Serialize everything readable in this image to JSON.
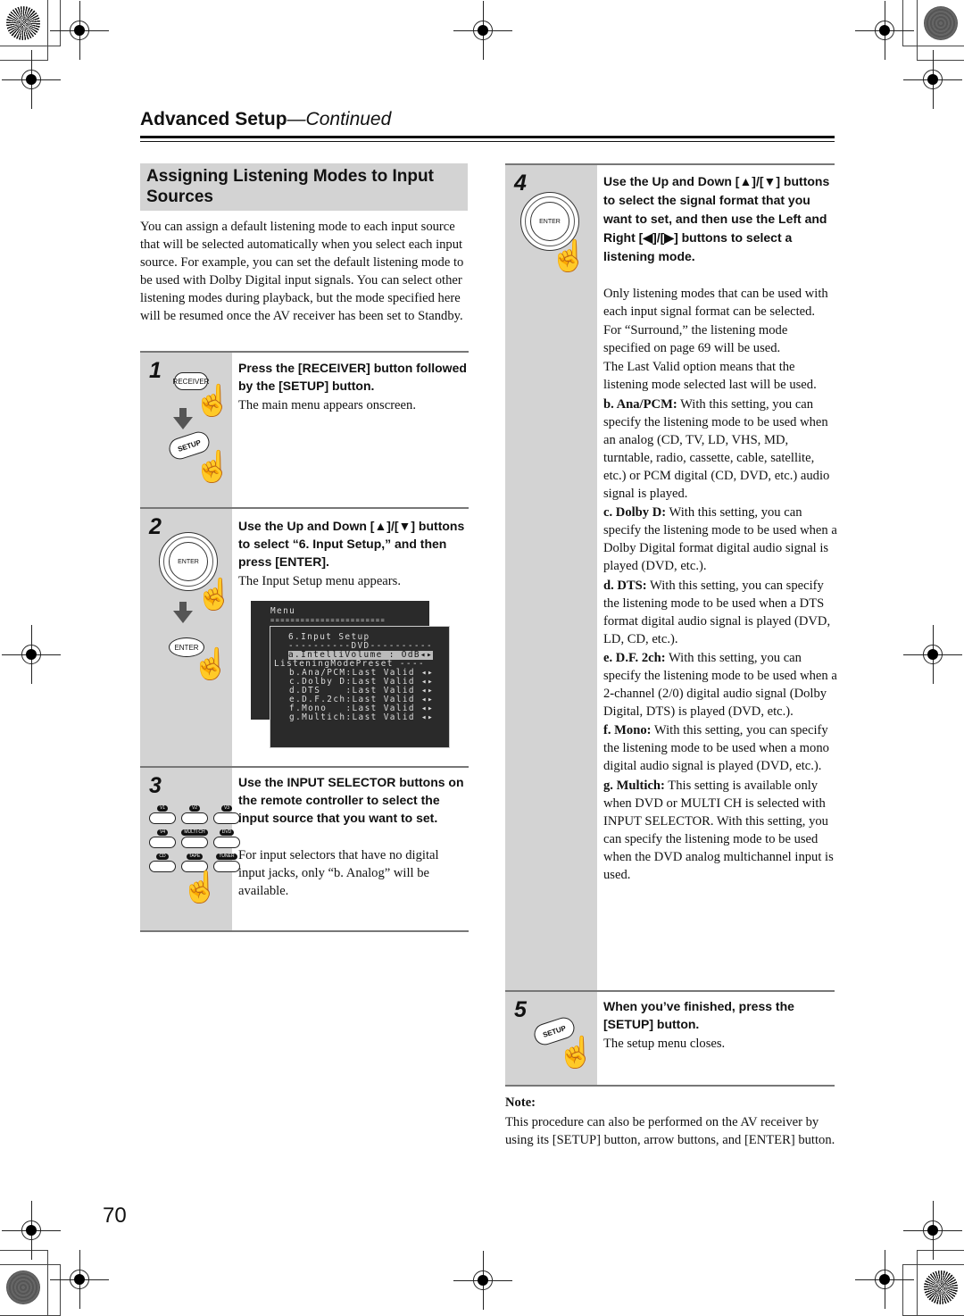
{
  "header": {
    "title_bold": "Advanced Setup",
    "title_italic": "—Continued"
  },
  "section_title": "Assigning Listening Modes to Input Sources",
  "intro": "You can assign a default listening mode to each input source that will be selected automatically when you select each input source. For example, you can set the default listening mode to be used with Dolby Digital input signals. You can select other listening modes during playback, but the mode specified here will be resumed once the AV receiver has been set to Standby.",
  "steps": [
    {
      "number": "1",
      "instruction": "Press the [RECEIVER] button followed by the [SETUP] button.",
      "description": "The main menu appears onscreen.",
      "buttons": [
        "RECEIVER",
        "SETUP"
      ]
    },
    {
      "number": "2",
      "instruction": "Use the Up and Down [▲]/[▼] buttons to select “6. Input Setup,” and then press [ENTER].",
      "description": "The Input Setup menu appears.",
      "buttons": [
        "ENTER",
        "ENTER"
      ]
    },
    {
      "number": "3",
      "instruction": "Use the INPUT SELECTOR buttons on the remote controller to select the input source that you want to set.",
      "description": "For input selectors that have no digital input jacks, only “b. Analog” will be available.",
      "selector_buttons": [
        "V1",
        "V2",
        "V3",
        "V4",
        "MULTI CH",
        "DVD",
        "CD",
        "TAPE",
        "TUNER"
      ]
    },
    {
      "number": "4",
      "instruction": "Use the Up and Down [▲]/[▼] buttons to select the signal format that you want to set, and then use the Left and Right [◀]/[▶] buttons to select a listening mode.",
      "paragraphs": [
        "Only listening modes that can be used with each input signal format can be selected.",
        "For “Surround,” the listening mode specified on page 69 will be used.",
        "The Last Valid option means that the listening mode selected last will be used."
      ],
      "definitions": [
        {
          "term": "b. Ana/PCM:",
          "text": " With this setting, you can specify the listening mode to be used when an analog (CD, TV, LD, VHS, MD, turntable, radio, cassette, cable, satellite, etc.) or PCM digital (CD, DVD, etc.) audio signal is played."
        },
        {
          "term": "c. Dolby D:",
          "text": " With this setting, you can specify the listening mode to be used when a Dolby Digital format digital audio signal is played (DVD, etc.)."
        },
        {
          "term": "d. DTS:",
          "text": " With this setting, you can specify the listening mode to be used when a DTS format digital audio signal is played (DVD, LD, CD, etc.)."
        },
        {
          "term": "e. D.F. 2ch:",
          "text": " With this setting, you can specify the listening mode to be used when a 2-channel (2/0) digital audio signal (Dolby Digital, DTS) is played (DVD, etc.)."
        },
        {
          "term": "f. Mono:",
          "text": " With this setting, you can specify the listening mode to be used when a mono digital audio signal is played (DVD, etc.)."
        },
        {
          "term": "g. Multich:",
          "text": " This setting is available only when DVD or MULTI CH is selected with INPUT SELECTOR. With this setting, you can specify the listening mode to be used when the DVD analog multichannel input is used."
        }
      ],
      "buttons": [
        "ENTER"
      ]
    },
    {
      "number": "5",
      "instruction": "When you’ve finished, press the [SETUP] button.",
      "description": "The setup menu closes.",
      "buttons": [
        "SETUP"
      ]
    }
  ],
  "osd": {
    "back_title": "Menu",
    "back_rule": "=======================",
    "lines": [
      "6.Input Setup",
      "----------DVD----------",
      "a.IntelliVolume : OdB◂▸",
      "ListeningModePreset ----",
      " b.Ana/PCM:Last Valid ◂▸",
      " c.Dolby D:Last Valid ◂▸",
      " d.DTS    :Last Valid ◂▸",
      " e.D.F.2ch:Last Valid ◂▸",
      " f.Mono   :Last Valid ◂▸",
      " g.Multich:Last Valid ◂▸"
    ]
  },
  "note": {
    "title": "Note:",
    "body": "This procedure can also be performed on the AV receiver by using its [SETUP] button, arrow buttons, and [ENTER] button."
  },
  "page_number": "70"
}
